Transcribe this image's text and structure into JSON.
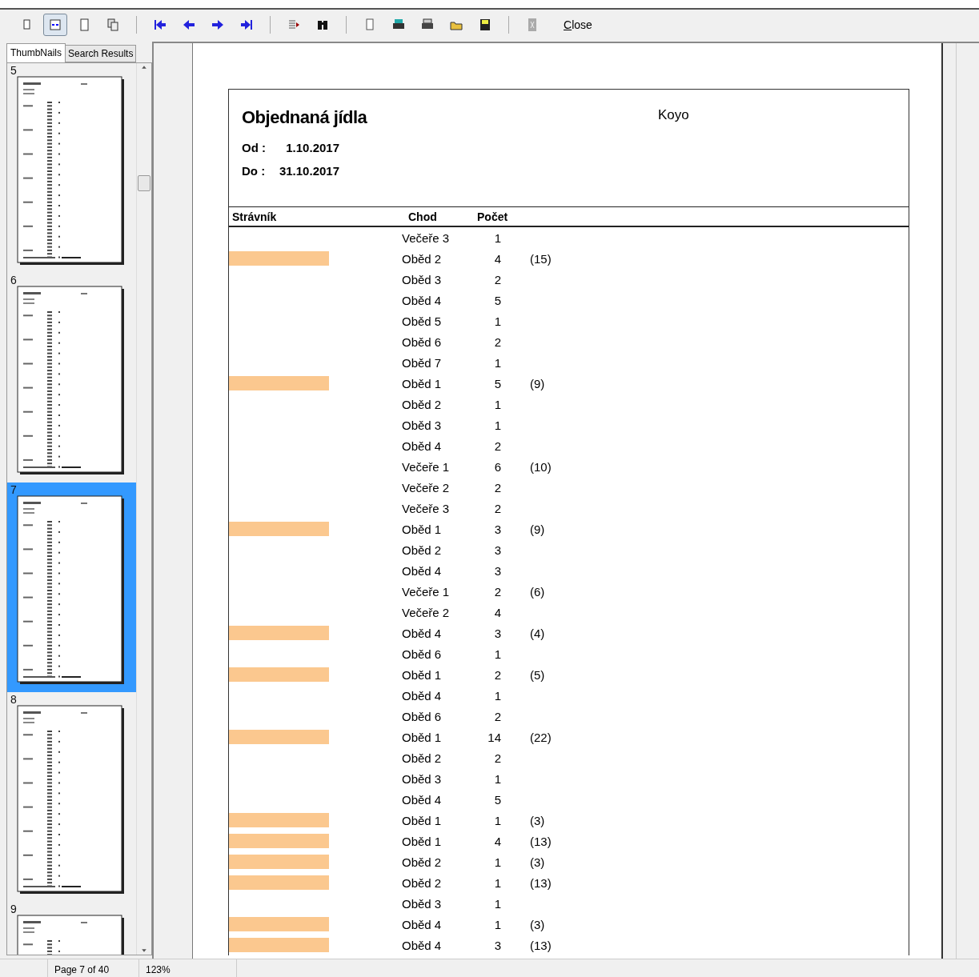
{
  "toolbar": {
    "close_label": "Close",
    "view_modes": [
      {
        "selected": false
      },
      {
        "selected": true
      },
      {
        "selected": false
      },
      {
        "selected": false
      }
    ]
  },
  "sidebar": {
    "tabs": [
      {
        "label": "ThumbNails",
        "selected": true
      },
      {
        "label": "Search Results",
        "selected": false
      }
    ],
    "thumbnails": [
      {
        "page": "5",
        "selected": false
      },
      {
        "page": "6",
        "selected": false
      },
      {
        "page": "7",
        "selected": true
      },
      {
        "page": "8",
        "selected": false
      },
      {
        "page": "9",
        "selected": false
      }
    ]
  },
  "report": {
    "title": "Objednaná jídla",
    "company": "Koyo",
    "from_label": "Od :",
    "from_value": "1.10.2017",
    "to_label": "Do :",
    "to_value": "31.10.2017",
    "columns": [
      "Strávník",
      "Chod",
      "Počet"
    ],
    "rows": [
      {
        "redacted": false,
        "course": "Večeře 3",
        "count": "1"
      },
      {
        "redacted": true,
        "course": "Oběd 2",
        "count": "4",
        "total": "(15)"
      },
      {
        "redacted": false,
        "course": "Oběd 3",
        "count": "2"
      },
      {
        "redacted": false,
        "course": "Oběd 4",
        "count": "5"
      },
      {
        "redacted": false,
        "course": "Oběd 5",
        "count": "1"
      },
      {
        "redacted": false,
        "course": "Oběd 6",
        "count": "2"
      },
      {
        "redacted": false,
        "course": "Oběd 7",
        "count": "1"
      },
      {
        "redacted": true,
        "course": "Oběd 1",
        "count": "5",
        "total": "(9)"
      },
      {
        "redacted": false,
        "course": "Oběd 2",
        "count": "1"
      },
      {
        "redacted": false,
        "course": "Oběd 3",
        "count": "1"
      },
      {
        "redacted": false,
        "course": "Oběd 4",
        "count": "2"
      },
      {
        "redacted": false,
        "course": "Večeře 1",
        "count": "6",
        "total": "(10)"
      },
      {
        "redacted": false,
        "course": "Večeře 2",
        "count": "2"
      },
      {
        "redacted": false,
        "course": "Večeře 3",
        "count": "2"
      },
      {
        "redacted": true,
        "course": "Oběd 1",
        "count": "3",
        "total": "(9)"
      },
      {
        "redacted": false,
        "course": "Oběd 2",
        "count": "3"
      },
      {
        "redacted": false,
        "course": "Oběd 4",
        "count": "3"
      },
      {
        "redacted": false,
        "course": "Večeře 1",
        "count": "2",
        "total": "(6)"
      },
      {
        "redacted": false,
        "course": "Večeře 2",
        "count": "4"
      },
      {
        "redacted": true,
        "course": "Oběd 4",
        "count": "3",
        "total": "(4)"
      },
      {
        "redacted": false,
        "course": "Oběd 6",
        "count": "1"
      },
      {
        "redacted": true,
        "course": "Oběd 1",
        "count": "2",
        "total": "(5)"
      },
      {
        "redacted": false,
        "course": "Oběd 4",
        "count": "1"
      },
      {
        "redacted": false,
        "course": "Oběd 6",
        "count": "2"
      },
      {
        "redacted": true,
        "course": "Oběd 1",
        "count": "14",
        "total": "(22)"
      },
      {
        "redacted": false,
        "course": "Oběd 2",
        "count": "2"
      },
      {
        "redacted": false,
        "course": "Oběd 3",
        "count": "1"
      },
      {
        "redacted": false,
        "course": "Oběd 4",
        "count": "5"
      },
      {
        "redacted": true,
        "course": "Oběd 1",
        "count": "1",
        "total": "(3)"
      },
      {
        "redacted": true,
        "course": "Oběd 1",
        "count": "4",
        "total": "(13)"
      },
      {
        "redacted": true,
        "course": "Oběd 2",
        "count": "1",
        "total": "(3)"
      },
      {
        "redacted": true,
        "course": "Oběd 2",
        "count": "1",
        "total": "(13)"
      },
      {
        "redacted": false,
        "course": "Oběd 3",
        "count": "1"
      },
      {
        "redacted": true,
        "course": "Oběd 4",
        "count": "1",
        "total": "(3)"
      },
      {
        "redacted": true,
        "course": "Oběd 4",
        "count": "3",
        "total": "(13)"
      }
    ]
  },
  "status_bar": {
    "page": "Page 7 of 40",
    "zoom": "123%"
  }
}
